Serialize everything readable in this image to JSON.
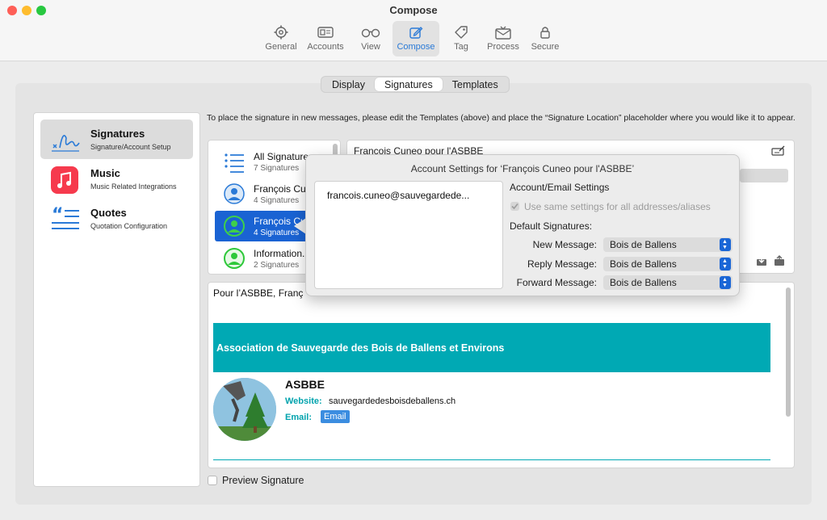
{
  "window": {
    "title": "Compose"
  },
  "toolbar": {
    "items": [
      {
        "label": "General",
        "icon": "gear-icon"
      },
      {
        "label": "Accounts",
        "icon": "id-card-icon"
      },
      {
        "label": "View",
        "icon": "glasses-icon"
      },
      {
        "label": "Compose",
        "icon": "compose-icon",
        "active": true
      },
      {
        "label": "Tag",
        "icon": "tag-icon"
      },
      {
        "label": "Process",
        "icon": "envelope-process-icon"
      },
      {
        "label": "Secure",
        "icon": "lock-icon"
      }
    ]
  },
  "tabs": [
    {
      "label": "Display"
    },
    {
      "label": "Signatures",
      "active": true
    },
    {
      "label": "Templates"
    }
  ],
  "sidebar": {
    "items": [
      {
        "title": "Signatures",
        "subtitle": "Signature/Account Setup",
        "icon": "signature-icon",
        "selected": true
      },
      {
        "title": "Music",
        "subtitle": "Music Related Integrations",
        "icon": "music-icon"
      },
      {
        "title": "Quotes",
        "subtitle": "Quotation Configuration",
        "icon": "quote-icon"
      }
    ]
  },
  "hint": "To place the signature in new messages, please edit the Templates (above) and place the “Signature Location” placeholder where you would like it to appear.",
  "accounts": [
    {
      "name": "All Signatures",
      "count": "7 Signatures",
      "icon": "list-icon"
    },
    {
      "name": "François Cu...",
      "count": "4 Signatures",
      "icon": "person-icon"
    },
    {
      "name": "François Cu",
      "count": "4 Signatures",
      "icon": "person-icon",
      "selected": true
    },
    {
      "name": "Information...",
      "count": "2 Signatures",
      "icon": "person-icon"
    }
  ],
  "signature": {
    "name": "Francois Cuneo pour l'ASBBE"
  },
  "preview": {
    "greeting": "Pour l’ASBBE, Franç",
    "banner": "Association de Sauvegarde des Bois de Ballens et Environs",
    "org": "ASBBE",
    "website_label": "Website:",
    "website_value": "sauvegardedesboisdeballens.ch",
    "email_label": "Email:",
    "email_button": "Email",
    "accent_color": "#00a9b4"
  },
  "preview_toggle": {
    "label": "Preview Signature",
    "checked": false
  },
  "popover": {
    "title": "Account Settings for ‘François Cuneo pour l'ASBBE’",
    "email": "francois.cuneo@sauvegardede...",
    "section_account": "Account/Email Settings",
    "same_settings": "Use same settings for all addresses/aliases",
    "section_defaults": "Default Signatures:",
    "rows": [
      {
        "label": "New Message:",
        "value": "Bois de Ballens"
      },
      {
        "label": "Reply Message:",
        "value": "Bois de Ballens"
      },
      {
        "label": "Forward Message:",
        "value": "Bois de Ballens"
      }
    ]
  }
}
